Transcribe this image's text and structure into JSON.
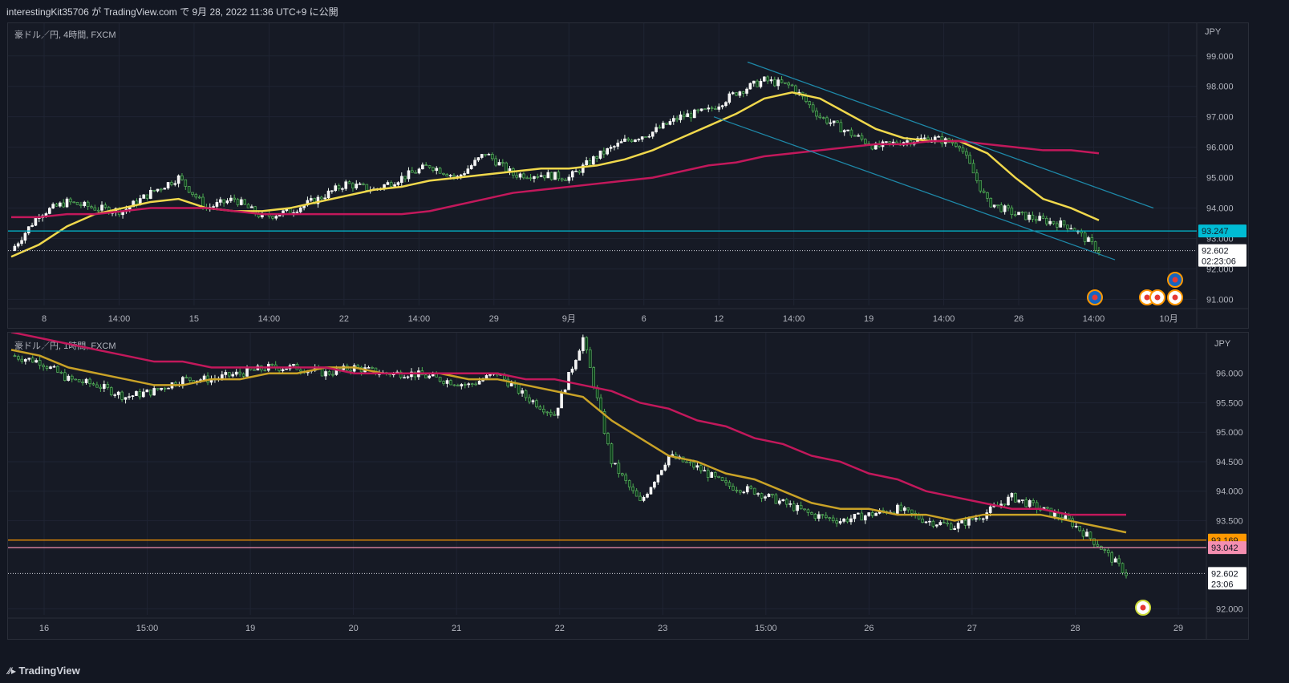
{
  "header": {
    "published": "interestingKit35706 が TradingView.com で 9月 28, 2022 11:36 UTC+9 に公開"
  },
  "footer": {
    "brand": "TradingView"
  },
  "chart_data": [
    {
      "type": "candlestick",
      "label": "豪ドル／円, 4時間, FXCM",
      "unit": "JPY",
      "ylim": [
        90.8,
        99.6
      ],
      "y_ticks": [
        "99.000",
        "98.000",
        "97.000",
        "96.000",
        "95.000",
        "94.000",
        "93.000",
        "92.000",
        "91.000"
      ],
      "x_ticks": [
        "8",
        "14:00",
        "15",
        "14:00",
        "22",
        "14:00",
        "29",
        "9月",
        "6",
        "12",
        "14:00",
        "19",
        "14:00",
        "26",
        "14:00",
        "10月"
      ],
      "price_badges": [
        {
          "value": "93.247",
          "color": "#00bcd4"
        },
        {
          "value": "92.602",
          "sub": "02:23:06",
          "color": "#ffffff"
        }
      ],
      "close_path": [
        92.6,
        93.8,
        94.2,
        94.0,
        93.9,
        94.5,
        95.0,
        94.0,
        94.3,
        93.7,
        93.9,
        94.3,
        94.8,
        94.6,
        95.0,
        95.4,
        95.0,
        95.8,
        95.1,
        95.1,
        95.0,
        95.7,
        96.2,
        96.5,
        97.0,
        97.2,
        97.8,
        98.2,
        98.0,
        97.0,
        96.5,
        96.0,
        96.2,
        96.3,
        96.1,
        94.2,
        93.8,
        93.6,
        93.4,
        92.6
      ],
      "series": [
        {
          "name": "EMA fast",
          "color": "#f0d84c",
          "values": [
            92.4,
            92.8,
            93.4,
            93.8,
            94.0,
            94.2,
            94.3,
            94.0,
            93.9,
            93.9,
            94.0,
            94.2,
            94.4,
            94.6,
            94.7,
            94.9,
            95.0,
            95.1,
            95.2,
            95.3,
            95.3,
            95.4,
            95.6,
            95.9,
            96.3,
            96.7,
            97.1,
            97.6,
            97.8,
            97.6,
            97.1,
            96.6,
            96.3,
            96.2,
            96.2,
            95.8,
            95.0,
            94.3,
            94.0,
            93.6
          ]
        },
        {
          "name": "EMA slow",
          "color": "#c2185b",
          "values": [
            93.7,
            93.7,
            93.8,
            93.8,
            93.9,
            94.0,
            94.0,
            94.0,
            93.9,
            93.8,
            93.8,
            93.8,
            93.8,
            93.8,
            93.8,
            93.9,
            94.1,
            94.3,
            94.5,
            94.6,
            94.7,
            94.8,
            94.9,
            95.0,
            95.2,
            95.4,
            95.5,
            95.7,
            95.8,
            95.9,
            96.0,
            96.1,
            96.1,
            96.2,
            96.2,
            96.1,
            96.0,
            95.9,
            95.9,
            95.8
          ]
        }
      ]
    },
    {
      "type": "candlestick",
      "label": "豪ドル／円, 1時間, FXCM",
      "unit": "JPY",
      "ylim": [
        91.9,
        96.5
      ],
      "y_ticks": [
        "96.000",
        "95.500",
        "95.000",
        "94.500",
        "94.000",
        "93.500",
        "92.000"
      ],
      "x_ticks": [
        "16",
        "15:00",
        "19",
        "20",
        "21",
        "22",
        "23",
        "15:00",
        "26",
        "27",
        "28",
        "29"
      ],
      "price_badges": [
        {
          "value": "93.169",
          "color": "#ff9800"
        },
        {
          "value": "93.042",
          "color": "#f48fb1"
        },
        {
          "value": "92.602",
          "sub": "23:06",
          "color": "#ffffff"
        }
      ],
      "close_path": [
        96.3,
        96.2,
        95.9,
        95.8,
        95.6,
        95.7,
        95.9,
        95.9,
        96.0,
        96.1,
        96.1,
        96.0,
        96.1,
        96.0,
        96.0,
        95.9,
        95.8,
        96.0,
        95.6,
        95.3,
        96.6,
        94.5,
        93.8,
        94.6,
        94.4,
        94.1,
        94.0,
        93.8,
        93.6,
        93.5,
        93.6,
        93.7,
        93.5,
        93.4,
        93.6,
        93.9,
        93.7,
        93.5,
        93.1,
        92.6
      ],
      "series": [
        {
          "name": "EMA fast",
          "color": "#c9a227",
          "values": [
            96.4,
            96.3,
            96.1,
            96.0,
            95.9,
            95.8,
            95.8,
            95.9,
            95.9,
            96.0,
            96.0,
            96.1,
            96.1,
            96.0,
            96.0,
            96.0,
            95.9,
            95.9,
            95.8,
            95.7,
            95.6,
            95.2,
            94.9,
            94.6,
            94.5,
            94.3,
            94.2,
            94.0,
            93.8,
            93.7,
            93.7,
            93.6,
            93.6,
            93.5,
            93.6,
            93.6,
            93.6,
            93.5,
            93.4,
            93.3
          ]
        },
        {
          "name": "EMA slow",
          "color": "#c2185b",
          "values": [
            96.7,
            96.6,
            96.5,
            96.4,
            96.3,
            96.2,
            96.2,
            96.1,
            96.1,
            96.1,
            96.1,
            96.1,
            96.0,
            96.0,
            96.0,
            96.0,
            96.0,
            96.0,
            95.9,
            95.9,
            95.8,
            95.7,
            95.5,
            95.4,
            95.2,
            95.1,
            94.9,
            94.8,
            94.6,
            94.5,
            94.3,
            94.2,
            94.0,
            93.9,
            93.8,
            93.7,
            93.7,
            93.6,
            93.6,
            93.6
          ]
        }
      ]
    }
  ]
}
